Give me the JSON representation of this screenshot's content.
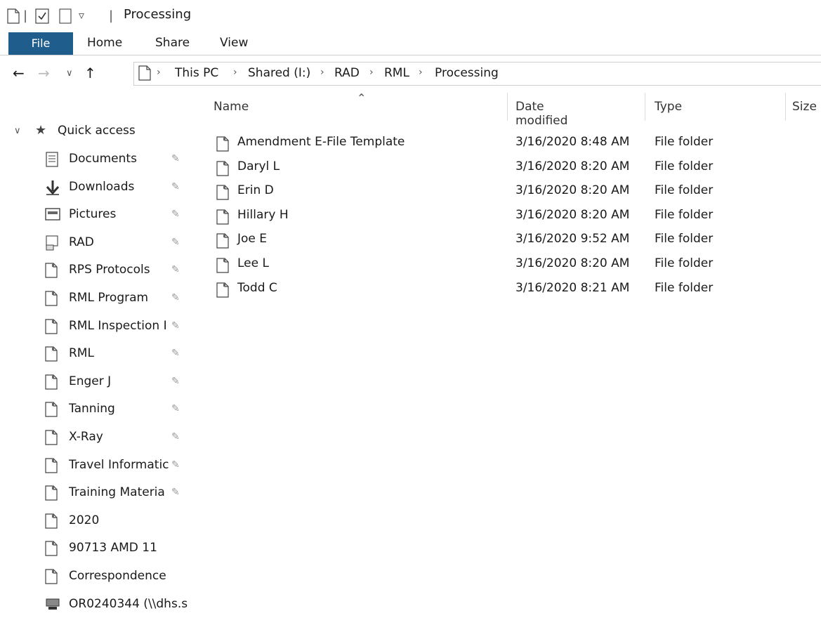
{
  "title": "Processing",
  "ribbon": {
    "tabs": [
      "File",
      "Home",
      "Share",
      "View"
    ]
  },
  "nav": {
    "back_icon": "arrow-left-icon",
    "forward_icon": "arrow-right-icon",
    "recent_icon": "chevron-down-icon",
    "up_icon": "arrow-up-icon",
    "breadcrumb": [
      "This PC",
      "Shared (I:)",
      "RAD",
      "RML",
      "Processing"
    ]
  },
  "sidebar": {
    "quick_access": "Quick access",
    "items": [
      {
        "label": "Documents",
        "icon": "documents-icon",
        "pinned": true
      },
      {
        "label": "Downloads",
        "icon": "downloads-icon",
        "pinned": true
      },
      {
        "label": "Pictures",
        "icon": "pictures-icon",
        "pinned": true
      },
      {
        "label": "RAD",
        "icon": "network-drive-icon",
        "pinned": true
      },
      {
        "label": "RPS Protocols",
        "icon": "folder-icon",
        "pinned": true
      },
      {
        "label": "RML Program",
        "icon": "folder-icon",
        "pinned": true
      },
      {
        "label": "RML Inspection I",
        "icon": "folder-icon",
        "pinned": true
      },
      {
        "label": "RML",
        "icon": "folder-icon",
        "pinned": true
      },
      {
        "label": "Enger J",
        "icon": "folder-icon",
        "pinned": true
      },
      {
        "label": "Tanning",
        "icon": "folder-icon",
        "pinned": true
      },
      {
        "label": "X-Ray",
        "icon": "folder-icon",
        "pinned": true
      },
      {
        "label": "Travel Informatic",
        "icon": "folder-icon",
        "pinned": true
      },
      {
        "label": "Training Materia",
        "icon": "folder-icon",
        "pinned": true
      },
      {
        "label": "2020",
        "icon": "folder-icon",
        "pinned": false
      },
      {
        "label": "90713 AMD 11",
        "icon": "folder-icon",
        "pinned": false
      },
      {
        "label": "Correspondence",
        "icon": "folder-icon",
        "pinned": false
      },
      {
        "label": "OR0240344 (\\\\dhs.s",
        "icon": "computer-icon",
        "pinned": false
      }
    ]
  },
  "list": {
    "columns": [
      "Name",
      "Date modified",
      "Type",
      "Size"
    ],
    "rows": [
      {
        "name": "Amendment E-File Template",
        "date": "3/16/2020 8:48 AM",
        "type": "File folder"
      },
      {
        "name": "Daryl L",
        "date": "3/16/2020 8:20 AM",
        "type": "File folder"
      },
      {
        "name": "Erin D",
        "date": "3/16/2020 8:20 AM",
        "type": "File folder"
      },
      {
        "name": "Hillary H",
        "date": "3/16/2020 8:20 AM",
        "type": "File folder"
      },
      {
        "name": "Joe E",
        "date": "3/16/2020 9:52 AM",
        "type": "File folder"
      },
      {
        "name": "Lee L",
        "date": "3/16/2020 8:20 AM",
        "type": "File folder"
      },
      {
        "name": "Todd C",
        "date": "3/16/2020 8:21 AM",
        "type": "File folder"
      }
    ]
  },
  "colors": {
    "file_tab": "#1f5d8d"
  }
}
